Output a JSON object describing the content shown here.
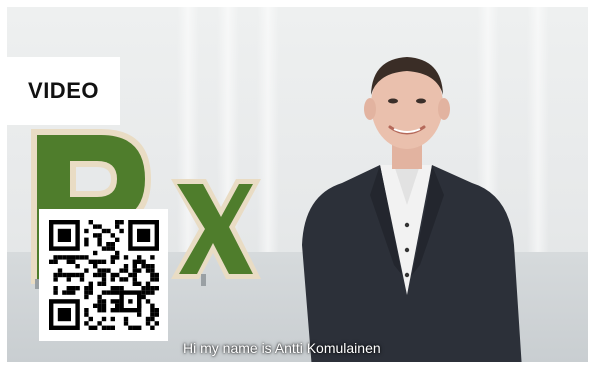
{
  "badge": {
    "label": "VIDEO"
  },
  "video": {
    "subtitle": "Hi my name is Antti Komulainen",
    "logo_letters": "Px"
  },
  "qr_code": {
    "icon": "qr-code-icon"
  },
  "colors": {
    "logo_green": "#4f7d2c",
    "logo_frame": "#e9dcc4",
    "suit": "#2c3039",
    "shirt": "#f2f2f2"
  }
}
